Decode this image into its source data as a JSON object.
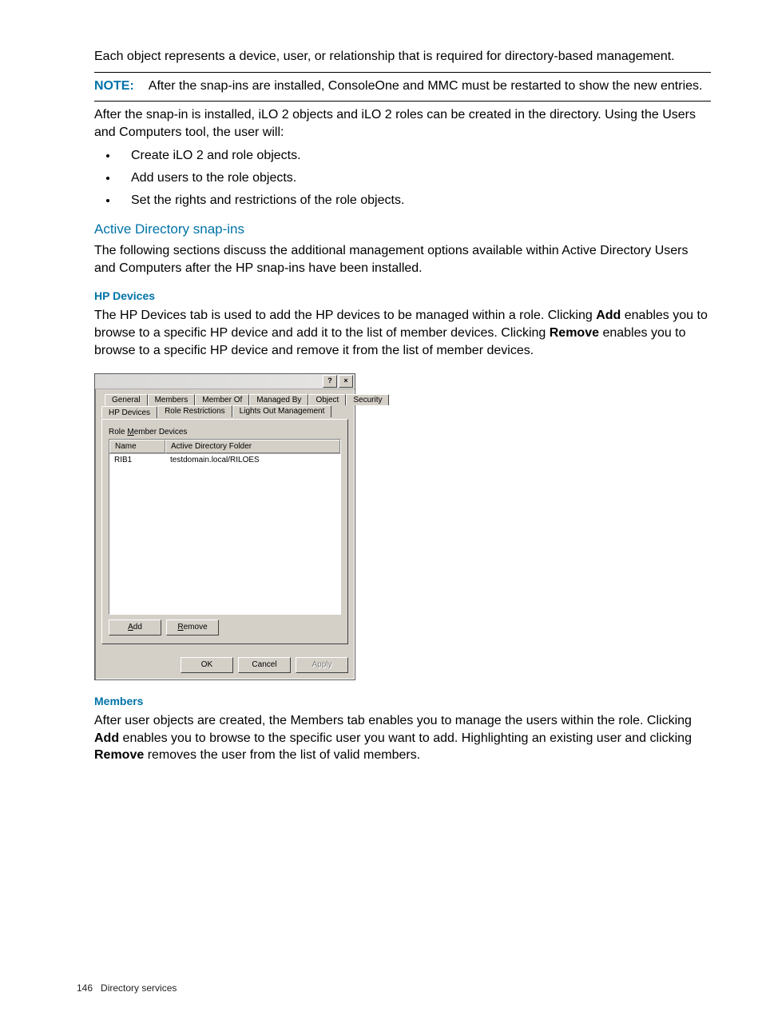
{
  "intro": "Each object represents a device, user, or relationship that is required for directory-based management.",
  "note_label": "NOTE:",
  "note_text": "After the snap-ins are installed, ConsoleOne and MMC must be restarted to show the new entries.",
  "after_install": "After the snap-in is installed, iLO 2 objects and iLO 2 roles can be created in the directory. Using the Users and Computers tool, the user will:",
  "bullets": [
    "Create iLO 2 and role objects.",
    "Add users to the role objects.",
    "Set the rights and restrictions of the role objects."
  ],
  "h_ad_snapins": "Active Directory snap-ins",
  "ad_snapins_text": "The following sections discuss the additional management options available within Active Directory Users and Computers after the HP snap-ins have been installed.",
  "h_hp_devices": "HP Devices",
  "hp_devices_p1a": "The HP Devices tab is used to add the HP devices to be managed within a role. Clicking ",
  "hp_devices_add": "Add",
  "hp_devices_p1b": " enables you to browse to a specific HP device and add it to the list of member devices. Clicking ",
  "hp_devices_remove": "Remove",
  "hp_devices_p1c": " enables you to browse to a specific HP device and remove it from the list of member devices.",
  "dialog": {
    "help_btn": "?",
    "close_btn": "×",
    "tabs_back": [
      "General",
      "Members",
      "Member Of",
      "Managed By",
      "Object",
      "Security"
    ],
    "tabs_front": [
      "HP Devices",
      "Role Restrictions",
      "Lights Out Management"
    ],
    "panel_label_pre": "Role ",
    "panel_label_u": "M",
    "panel_label_post": "ember Devices",
    "cols": {
      "name": "Name",
      "folder": "Active Directory Folder"
    },
    "rows": [
      {
        "name": "RIB1",
        "folder": "testdomain.local/RILOES"
      }
    ],
    "btn_add_u": "A",
    "btn_add_post": "dd",
    "btn_remove_u": "R",
    "btn_remove_post": "emove",
    "btn_ok": "OK",
    "btn_cancel": "Cancel",
    "btn_apply": "Apply"
  },
  "h_members": "Members",
  "members_p1a": "After user objects are created, the Members tab enables you to manage the users within the role. Clicking ",
  "members_add": "Add",
  "members_p1b": " enables you to browse to the specific user you want to add. Highlighting an existing user and clicking ",
  "members_remove": "Remove",
  "members_p1c": " removes the user from the list of valid members.",
  "footer_page": "146",
  "footer_section": "Directory services"
}
